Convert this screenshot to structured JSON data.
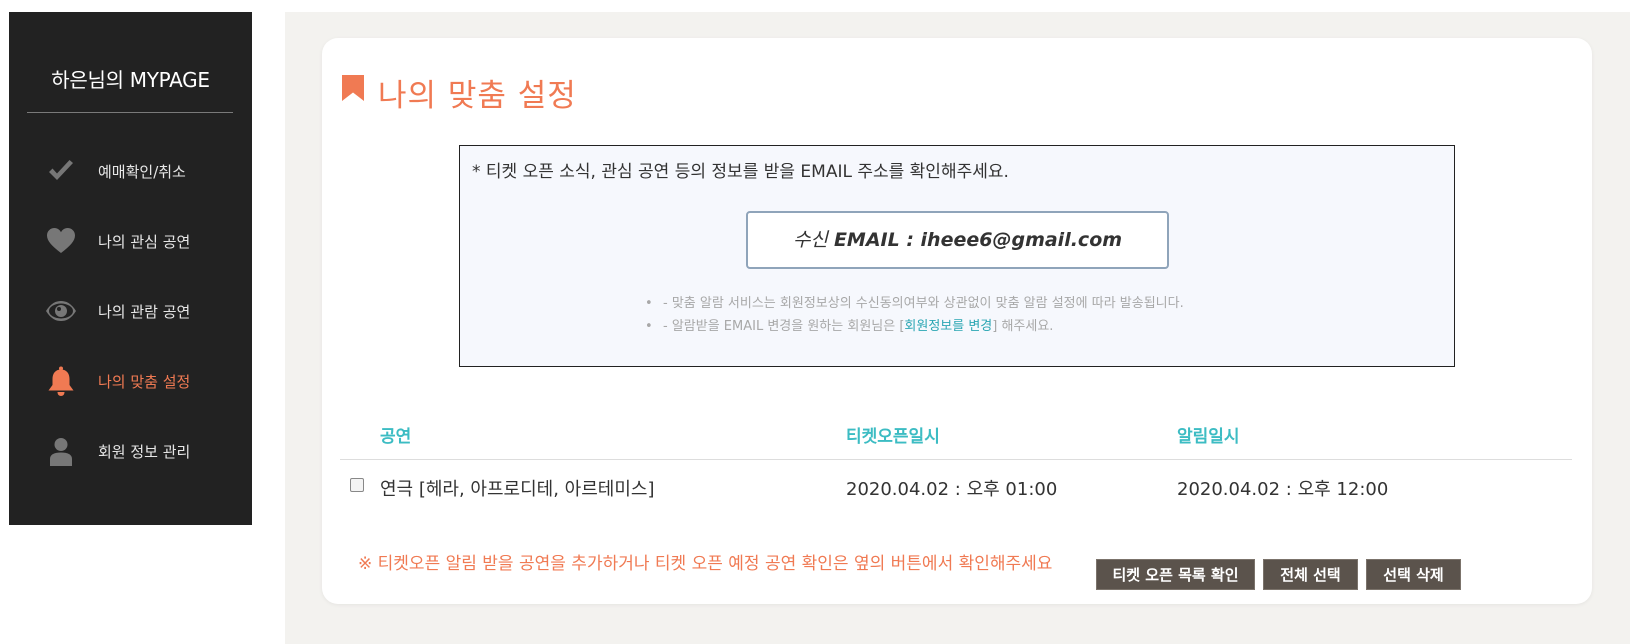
{
  "sidebar": {
    "title": "하은님의 MYPAGE",
    "items": [
      {
        "label": "예매확인/취소",
        "icon": "check-icon",
        "active": false
      },
      {
        "label": "나의 관심 공연",
        "icon": "heart-icon",
        "active": false
      },
      {
        "label": "나의 관람 공연",
        "icon": "eye-icon",
        "active": false
      },
      {
        "label": "나의 맞춤 설정",
        "icon": "bell-icon",
        "active": true
      },
      {
        "label": "회원 정보 관리",
        "icon": "user-icon",
        "active": false
      }
    ]
  },
  "main": {
    "title": "나의 맞춤 설정",
    "title_icon": "bookmark-icon",
    "email_section": {
      "notice": "* 티켓 오픈 소식, 관심 공연 등의 정보를 받을 EMAIL 주소를 확인해주세요.",
      "email_prefix": "수신",
      "email_label": "EMAIL : iheee6@gmail.com",
      "notes": [
        {
          "text": "- 맞춤 알람 서비스는 회원정보상의 수신동의여부와 상관없이 맞춤 알람 설정에 따라 발송됩니다."
        },
        {
          "text_before": "- 알람받을 EMAIL 변경을 원하는 회원님은 [",
          "link": "회원정보를 변경",
          "text_after": "] 해주세요."
        }
      ]
    },
    "table": {
      "headers": {
        "show": "공연",
        "open_date": "티켓오픈일시",
        "alarm_date": "알림일시"
      },
      "rows": [
        {
          "show": "연극 [헤라, 아프로디테, 아르테미스]",
          "open_date": "2020.04.02 : 오후 01:00",
          "alarm_date": "2020.04.02 : 오후 12:00",
          "checked": false
        }
      ]
    },
    "footer_note": "※ 티켓오픈 알림 받을 공연을 추가하거나 티켓 오픈 예정 공연 확인은 옆의 버튼에서 확인해주세요",
    "buttons": {
      "ticket_list": "티켓 오픈 목록 확인",
      "select_all": "전체 선택",
      "delete_selected": "선택 삭제"
    }
  },
  "colors": {
    "accent": "#f07a53",
    "teal": "#3cbcc3",
    "sidebar_bg": "#222222",
    "button_bg": "#5b534c"
  }
}
